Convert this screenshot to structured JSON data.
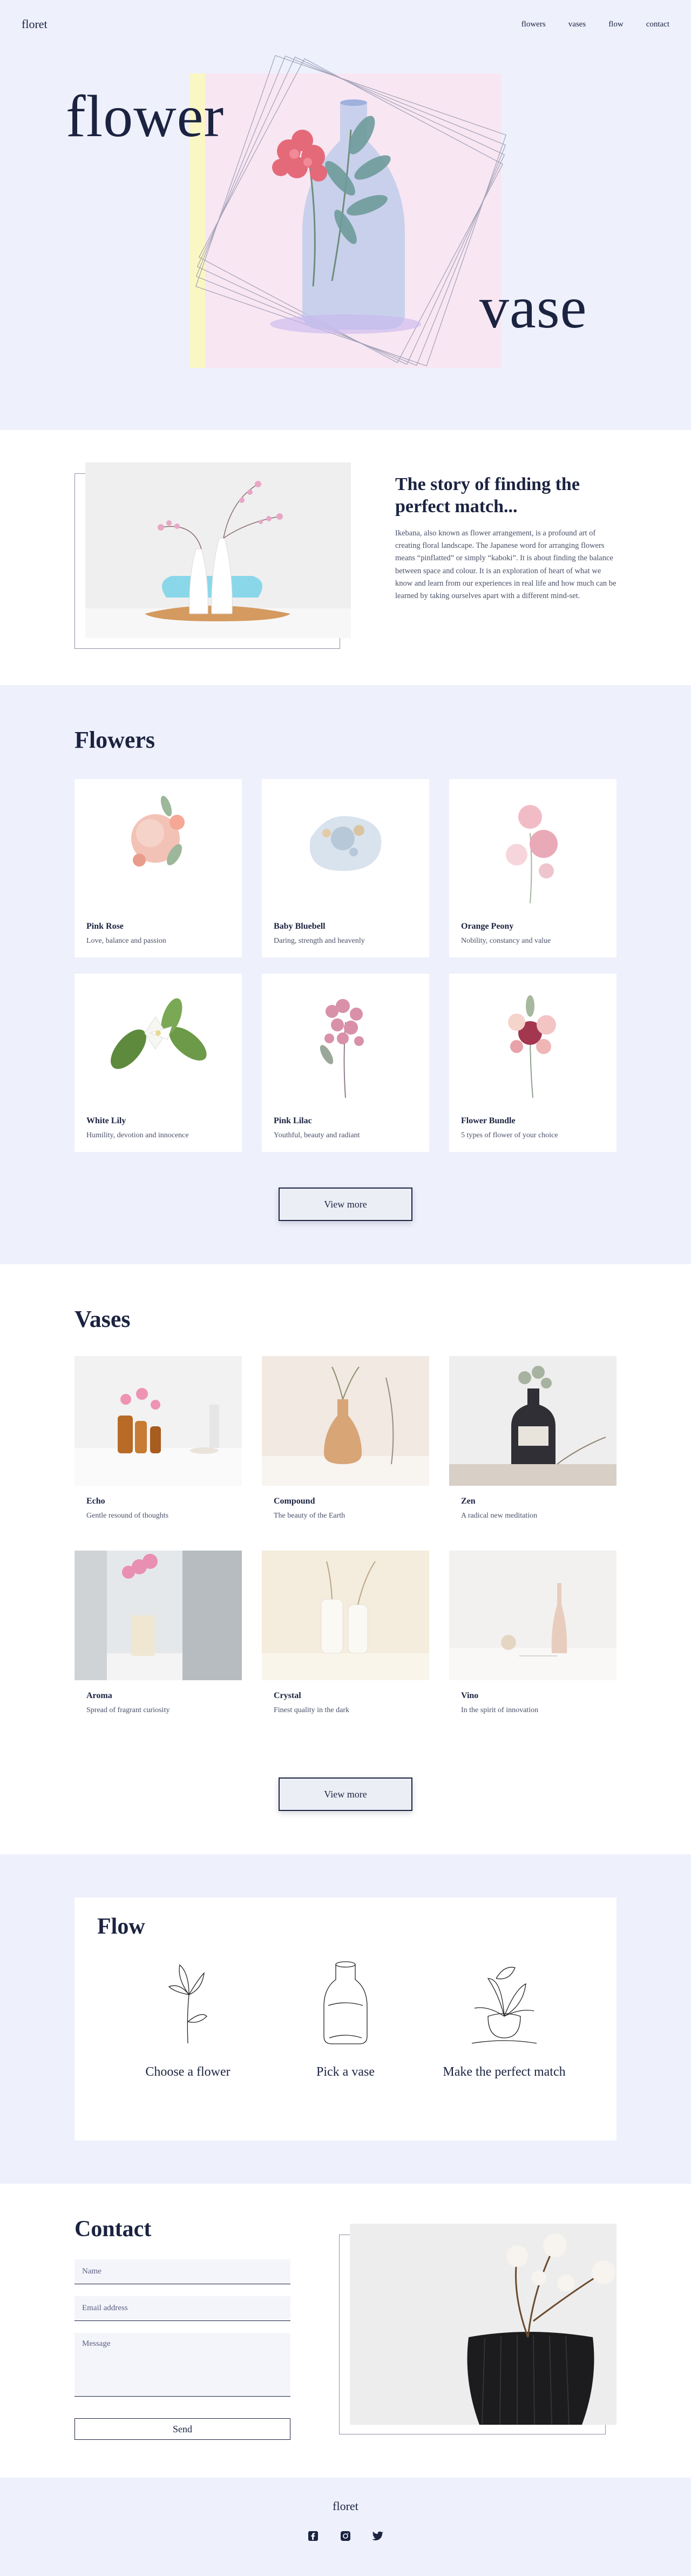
{
  "nav": {
    "logo": "floret",
    "links": [
      "flowers",
      "vases",
      "flow",
      "contact"
    ]
  },
  "hero": {
    "word_left": "flower",
    "word_right": "vase"
  },
  "story": {
    "title": "The story of finding the perfect match...",
    "body": "Ikebana, also known as flower arrangement, is a profound art of creating floral landscape. The Japanese word for arranging flowers means “pinflatted” or simply “kaboki”. It is about finding the balance between space and colour. It is an exploration of heart of what we know and learn from our experiences in real life and how much can be learned by taking ourselves apart with a different mind-set."
  },
  "flowers": {
    "title": "Flowers",
    "items": [
      {
        "name": "Pink Rose",
        "desc": "Love, balance and passion"
      },
      {
        "name": "Baby Bluebell",
        "desc": "Daring, strength and heavenly"
      },
      {
        "name": "Orange Peony",
        "desc": "Nobility, constancy and value"
      },
      {
        "name": "White Lily",
        "desc": "Humility, devotion and innocence"
      },
      {
        "name": "Pink Lilac",
        "desc": "Youthful, beauty and radiant"
      },
      {
        "name": "Flower Bundle",
        "desc": "5 types of flower of your choice"
      }
    ],
    "button": "View more"
  },
  "vases": {
    "title": "Vases",
    "items": [
      {
        "name": "Echo",
        "desc": "Gentle resound of thoughts"
      },
      {
        "name": "Compound",
        "desc": "The beauty of the Earth"
      },
      {
        "name": "Zen",
        "desc": "A radical new meditation"
      },
      {
        "name": "Aroma",
        "desc": "Spread of fragrant curiosity"
      },
      {
        "name": "Crystal",
        "desc": "Finest quality in the dark"
      },
      {
        "name": "Vino",
        "desc": "In the spirit of innovation"
      }
    ],
    "button": "View more"
  },
  "flow": {
    "title": "Flow",
    "steps": [
      "Choose a flower",
      "Pick a vase",
      "Make the perfect match"
    ]
  },
  "contact": {
    "title": "Contact",
    "name_placeholder": "Name",
    "email_placeholder": "Email address",
    "message_placeholder": "Message",
    "send": "Send"
  },
  "footer": {
    "logo": "floret",
    "social_icons": [
      "facebook-icon",
      "instagram-icon",
      "twitter-icon"
    ]
  },
  "colors": {
    "navy": "#1b2340",
    "lavender_bg": "#eef0fc",
    "hero_pink": "#f8e6f2",
    "hero_yellow": "#fbf7c4"
  }
}
